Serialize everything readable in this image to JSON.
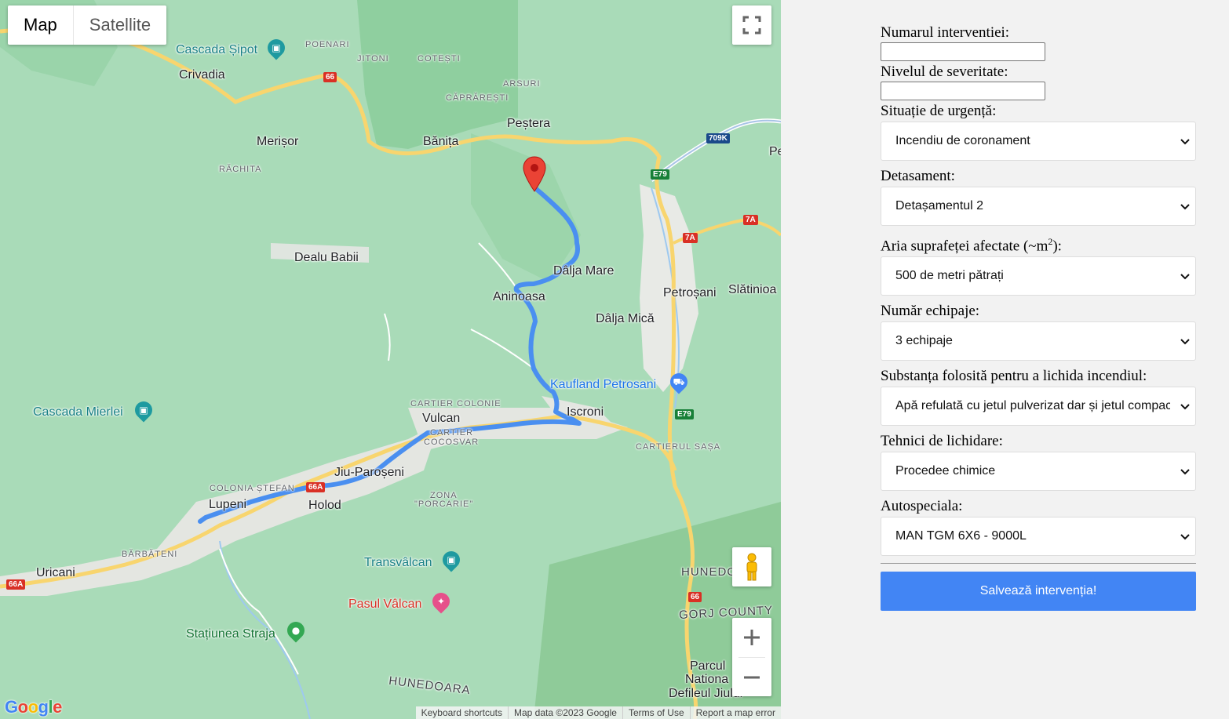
{
  "map": {
    "type_control": {
      "map": "Map",
      "satellite": "Satellite"
    },
    "labels": {
      "cascada_sipot": "Cascada Șipot",
      "poenari": "POENARI",
      "jitoni": "JITONI",
      "cotesti": "COTEȘTI",
      "crivadia": "Crivadia",
      "arsuri": "ARSURI",
      "caprarest": "CĂPRĂREȘTI",
      "pestera": "Peștera",
      "merisor": "Merișor",
      "banita": "Bănița",
      "rachita": "RĂCHITA",
      "dealu_babii": "Dealu Babii",
      "dalja_mare": "Dâlja Mare",
      "aninoasa": "Aninoasa",
      "petrosani": "Petroșani",
      "slatinioa": "Slătinioa",
      "dalja_mica": "Dâlja Mică",
      "kaufland": "Kaufland Petrosani",
      "cascada_mierlei": "Cascada Mierlei",
      "cartier_colonie": "CARTIER COLONIE",
      "vulcan": "Vulcan",
      "iscroni": "Iscroni",
      "cartier_cocosvar_1": "CARTIER",
      "cartier_cocosvar_2": "COCOSVAR",
      "cartierul_sasa": "CARTIERUL SAȘA",
      "colonia_stefan": "COLONIA ȘTEFAN",
      "jiu_paroseni": "Jiu-Paroșeni",
      "lupeni": "Lupeni",
      "holod": "Holod",
      "zona_porcarie_1": "ZONA",
      "zona_porcarie_2": "\"PORCARIE\"",
      "barbateni": "BĂRBĂTENI",
      "uricani": "Uricani",
      "transvalcan": "Transvâlcan",
      "pasul_valcan": "Pasul Vâlcan",
      "statiunea_straja": "Stațiunea Straja",
      "hunedoara_bottom": "HUNEDOARA",
      "hunedo_right": "HUNEDO",
      "gorj_county": "GORJ COUNTY",
      "parcul_1": "Parcul",
      "parcul_2": "Nationa",
      "parcul_3": "Defileul Jiului",
      "pe": "Pe"
    },
    "shields": {
      "r66a": "66",
      "r709k": "709K",
      "e79a": "E79",
      "r7a1": "7A",
      "r7a2": "7A",
      "e79b": "E79",
      "r66a2": "66A",
      "r66a3": "66A",
      "r66b": "66"
    },
    "footer": {
      "shortcuts": "Keyboard shortcuts",
      "data": "Map data ©2023 Google",
      "terms": "Terms of Use",
      "report": "Report a map error"
    },
    "logo": "Google",
    "route_color": "#4a8ff0",
    "marker_color": "#ea4335"
  },
  "form": {
    "numar_label": "Numarul interventiei:",
    "numar_value": "",
    "severitate_label": "Nivelul de severitate:",
    "severitate_value": "",
    "situatie_label": "Situație de urgență:",
    "situatie_value": "Incendiu de coronament",
    "detasament_label": "Detasament:",
    "detasament_value": "Detașamentul 2",
    "aria_label": "Aria suprafeței afectate (~m",
    "aria_sup": "2",
    "aria_label_end": "):",
    "aria_value": "500 de metri pătrați",
    "echipaje_label": "Număr echipaje:",
    "echipaje_value": "3 echipaje",
    "substanta_label": "Substanța folosită pentru a lichida incendiul:",
    "substanta_value": "Apă refulată cu jetul pulverizat dar și jetul compact",
    "tehnici_label": "Tehnici de lichidare:",
    "tehnici_value": "Procedee chimice",
    "autospeciala_label": "Autospeciala:",
    "autospeciala_value": "MAN TGM 6X6 - 9000L",
    "save_label": "Salvează intervenția!",
    "accent": "#4285f4"
  }
}
